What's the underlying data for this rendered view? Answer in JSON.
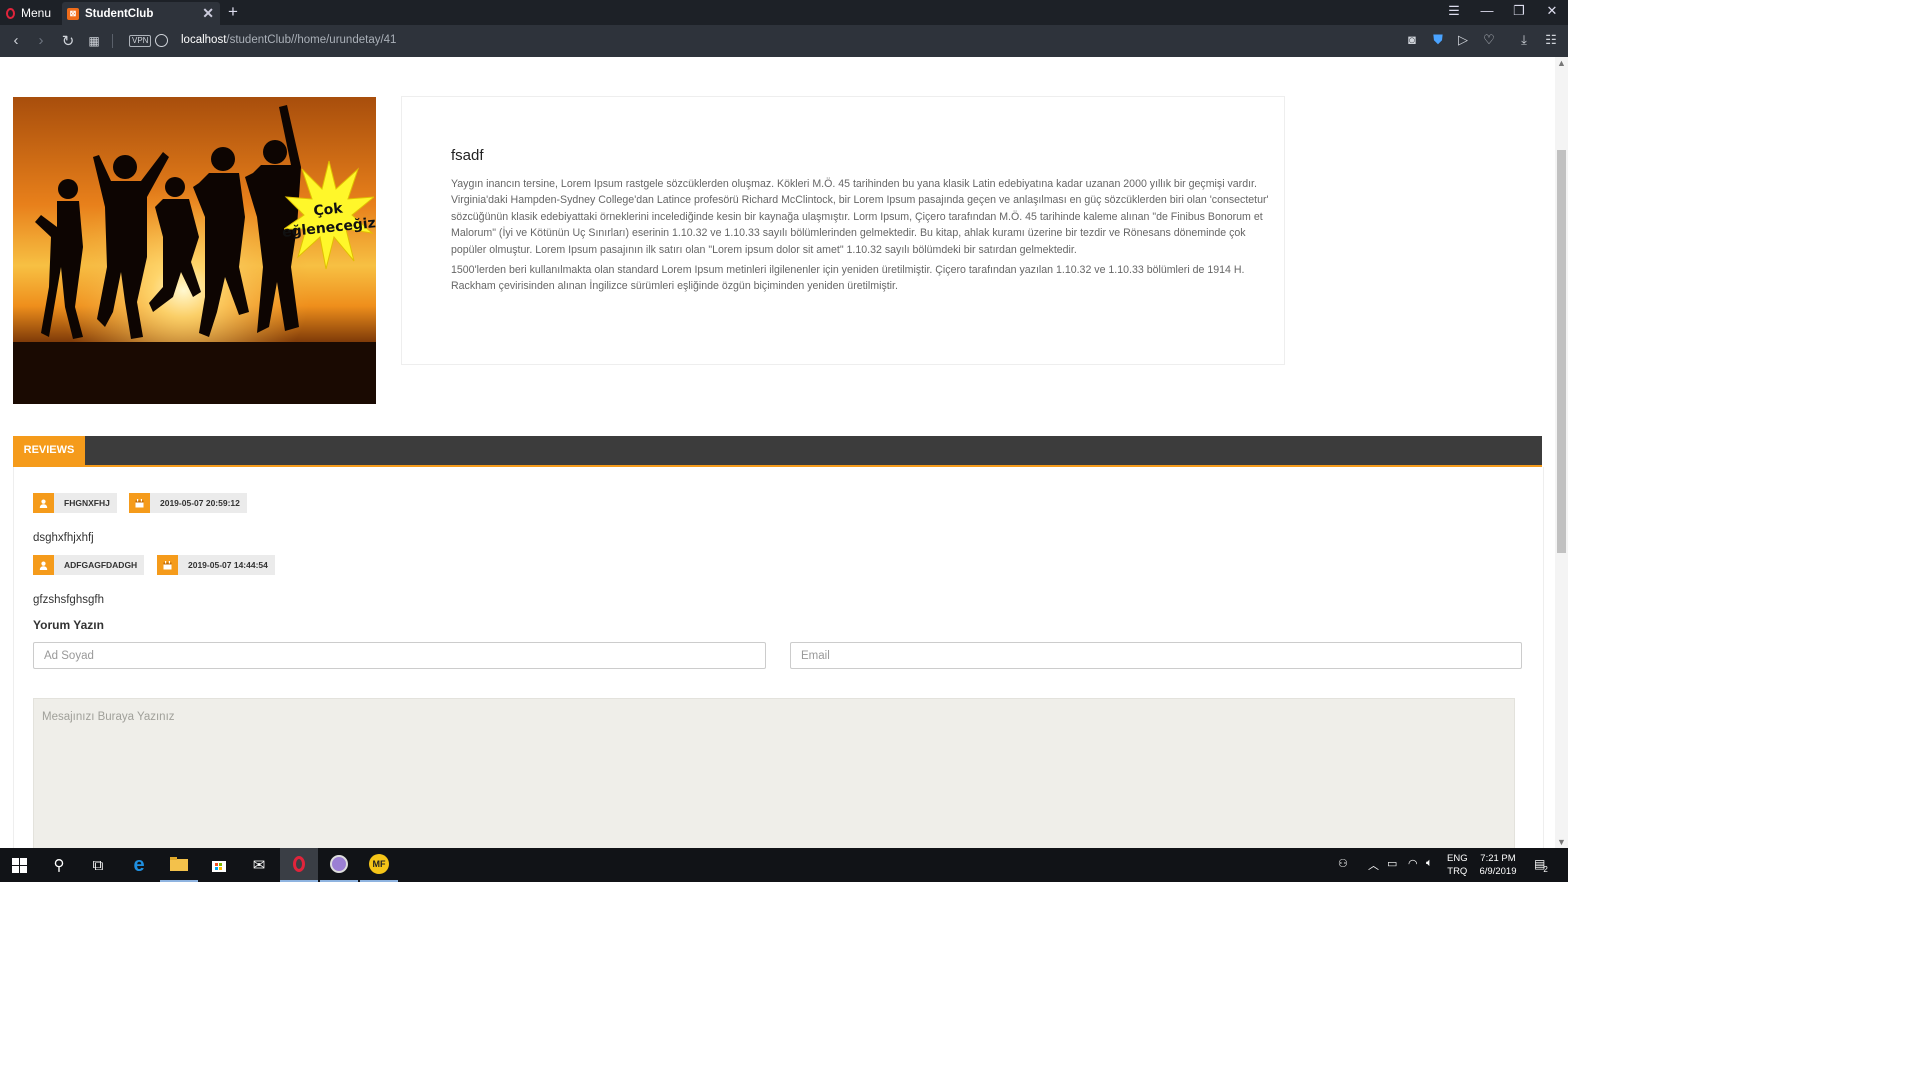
{
  "browser": {
    "menu_label": "Menu",
    "tab_title": "StudentClub",
    "url_host": "localhost",
    "url_path": "/studentClub//home/urundetay/41",
    "vpn_label": "VPN"
  },
  "product": {
    "image_caption": "Çok eğleneceğiz!",
    "title": "fsadf",
    "description": [
      "Yaygın inancın tersine, Lorem Ipsum rastgele sözcüklerden oluşmaz. Kökleri M.Ö. 45 tarihinden bu yana klasik Latin edebiyatına kadar uzanan 2000 yıllık bir geçmişi vardır. Virginia'daki Hampden-Sydney College'dan Latince profesörü Richard McClintock, bir Lorem Ipsum pasajında geçen ve anlaşılması en güç sözcüklerden biri olan 'consectetur' sözcüğünün klasik edebiyattaki örneklerini incelediğinde kesin bir kaynağa ulaşmıştır. Lorm Ipsum, Çiçero tarafından M.Ö. 45 tarihinde kaleme alınan \"de Finibus Bonorum et Malorum\" (İyi ve Kötünün Uç Sınırları) eserinin 1.10.32 ve 1.10.33 sayılı bölümlerinden gelmektedir. Bu kitap, ahlak kuramı üzerine bir tezdir ve Rönesans döneminde çok popüler olmuştur. Lorem Ipsum pasajının ilk satırı olan \"Lorem ipsum dolor sit amet\" 1.10.32 sayılı bölümdeki bir satırdan gelmektedir.",
      "1500'lerden beri kullanılmakta olan standard Lorem Ipsum metinleri ilgilenenler için yeniden üretilmiştir. Çiçero tarafından yazılan 1.10.32 ve 1.10.33 bölümleri de 1914 H. Rackham çevirisinden alınan İngilizce sürümleri eşliğinde özgün biçiminden yeniden üretilmiştir."
    ]
  },
  "reviews": {
    "tab_label": "REVIEWS",
    "items": [
      {
        "author": "FHGNXFHJ",
        "date": "2019-05-07 20:59:12",
        "text": "dsghxfhjxhfj"
      },
      {
        "author": "ADFGAGFDADGH",
        "date": "2019-05-07 14:44:54",
        "text": "gfzshsfghsgfh"
      }
    ],
    "form": {
      "title": "Yorum Yazın",
      "name_placeholder": "Ad Soyad",
      "email_placeholder": "Email",
      "message_placeholder": "Mesajınızı Buraya Yazınız"
    }
  },
  "taskbar": {
    "lang_top": "ENG",
    "lang_bottom": "TRQ",
    "time": "7:21 PM",
    "date": "6/9/2019",
    "notification_count": "2"
  },
  "colors": {
    "accent": "#f59b1b",
    "reviews_bar": "#3c3c3c",
    "browser_dark": "#1d2127"
  }
}
